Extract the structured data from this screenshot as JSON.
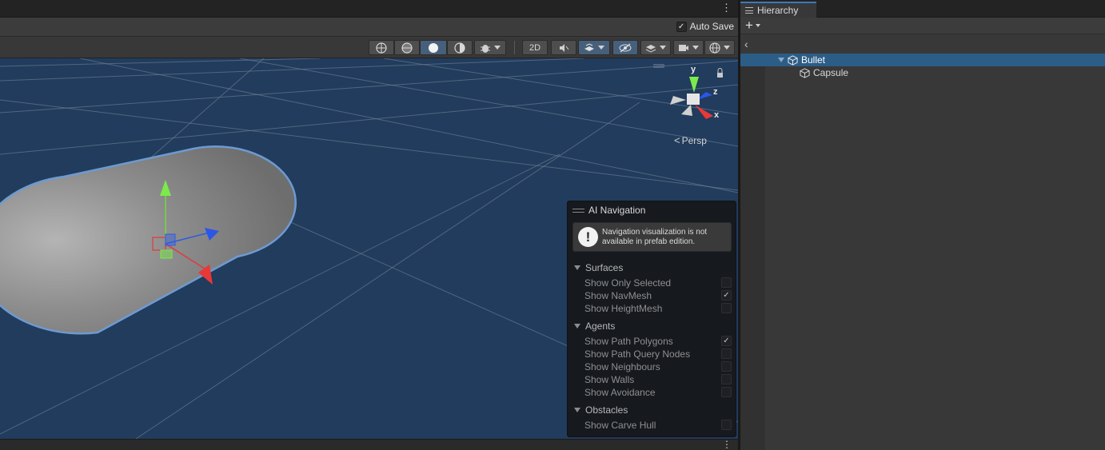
{
  "scene": {
    "autosave_label": "Auto Save",
    "autosave_checked": true,
    "toolbar": {
      "btn_2d": "2D"
    },
    "gizmo": {
      "axis_x": "x",
      "axis_y": "y",
      "axis_z": "z",
      "projection": "Persp"
    }
  },
  "ai_nav": {
    "title": "AI Navigation",
    "help": "Navigation visualization is not available in prefab edition.",
    "sections": {
      "surfaces": {
        "title": "Surfaces",
        "items": [
          {
            "label": "Show Only Selected",
            "checked": false
          },
          {
            "label": "Show NavMesh",
            "checked": true
          },
          {
            "label": "Show HeightMesh",
            "checked": false
          }
        ]
      },
      "agents": {
        "title": "Agents",
        "items": [
          {
            "label": "Show Path Polygons",
            "checked": true
          },
          {
            "label": "Show Path Query Nodes",
            "checked": false
          },
          {
            "label": "Show Neighbours",
            "checked": false
          },
          {
            "label": "Show Walls",
            "checked": false
          },
          {
            "label": "Show Avoidance",
            "checked": false
          }
        ]
      },
      "obstacles": {
        "title": "Obstacles",
        "items": [
          {
            "label": "Show Carve Hull",
            "checked": false
          }
        ]
      }
    }
  },
  "hierarchy": {
    "tab_label": "Hierarchy",
    "add_label": "+",
    "items": [
      {
        "label": "Bullet",
        "selected": true
      },
      {
        "label": "Capsule",
        "selected": false
      }
    ]
  },
  "icons": {
    "kebab": "⋮",
    "check": "✓",
    "back": "‹",
    "warning": "!"
  }
}
